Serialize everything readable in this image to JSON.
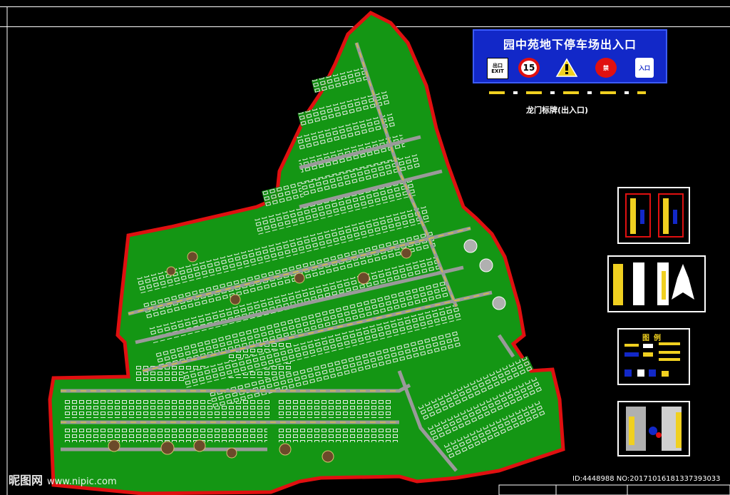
{
  "banner": {
    "title": "园中苑地下停车场出入口",
    "exit_sign": "出口 EXIT",
    "speed_limit": "15",
    "no_entry_sign": "禁",
    "entry_sign": "入口"
  },
  "caption": "龙门标牌(出入口)",
  "legend": {
    "title": "图例"
  },
  "watermark": {
    "brand": "昵图网",
    "url": "www.nipic.com"
  },
  "image_id": "ID:4448988 NO:20171016181337393033",
  "colors": {
    "background": "#000000",
    "lawn": "#149614",
    "boundary": "#e01010",
    "road": "#8a8a8a",
    "banner": "#1228c8",
    "accent_yellow": "#f0d020"
  }
}
